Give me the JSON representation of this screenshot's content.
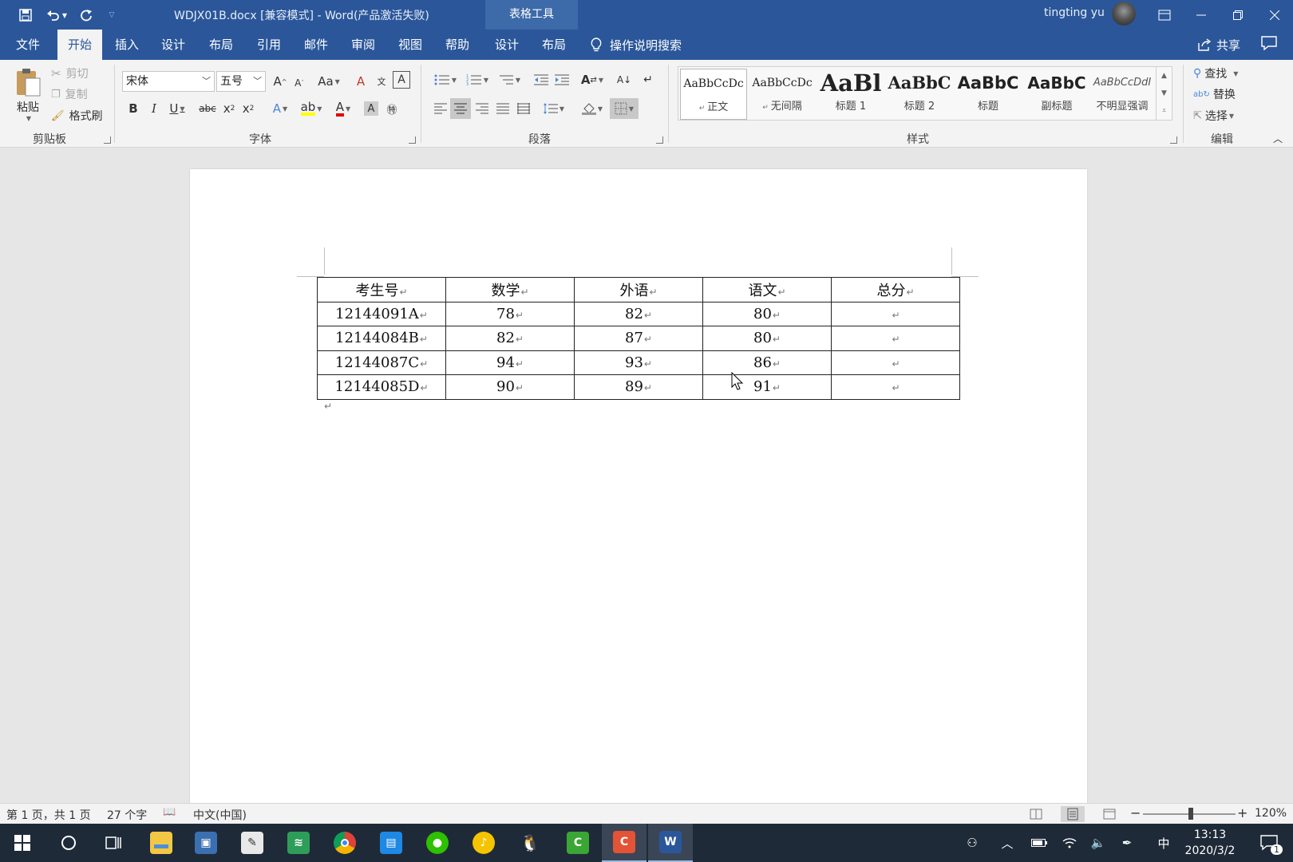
{
  "titlebar": {
    "doc_title": "WDJX01B.docx [兼容模式]  -  Word(产品激活失败)",
    "table_tools": "表格工具",
    "user_name": "tingting yu"
  },
  "tabs": [
    {
      "label": "文件"
    },
    {
      "label": "开始"
    },
    {
      "label": "插入"
    },
    {
      "label": "设计"
    },
    {
      "label": "布局"
    },
    {
      "label": "引用"
    },
    {
      "label": "邮件"
    },
    {
      "label": "审阅"
    },
    {
      "label": "视图"
    },
    {
      "label": "帮助"
    },
    {
      "label": "设计"
    },
    {
      "label": "布局"
    }
  ],
  "search_hint": "操作说明搜索",
  "share_label": "共享",
  "clipboard": {
    "paste": "粘贴",
    "cut": "剪切",
    "copy": "复制",
    "format_painter": "格式刷",
    "group_label": "剪贴板"
  },
  "font": {
    "name": "宋体",
    "size": "五号",
    "group_label": "字体",
    "aa": "Aa"
  },
  "paragraph": {
    "group_label": "段落"
  },
  "styles": {
    "group_label": "样式",
    "items": [
      {
        "preview": "AaBbCcDc",
        "name": "正文"
      },
      {
        "preview": "AaBbCcDc",
        "name": "无间隔"
      },
      {
        "preview": "AaBl",
        "name": "标题 1"
      },
      {
        "preview": "AaBbC",
        "name": "标题 2"
      },
      {
        "preview": "AaBbC",
        "name": "标题"
      },
      {
        "preview": "AaBbC",
        "name": "副标题"
      },
      {
        "preview": "AaBbCcDdI",
        "name": "不明显强调"
      }
    ]
  },
  "editing": {
    "find": "查找",
    "replace": "替换",
    "select": "选择",
    "group_label": "编辑"
  },
  "table": {
    "headers": [
      "考生号",
      "数学",
      "外语",
      "语文",
      "总分"
    ],
    "rows": [
      [
        "12144091A",
        "78",
        "82",
        "80",
        ""
      ],
      [
        "12144084B",
        "82",
        "87",
        "80",
        ""
      ],
      [
        "12144087C",
        "94",
        "93",
        "86",
        ""
      ],
      [
        "12144085D",
        "90",
        "89",
        "91",
        ""
      ]
    ],
    "para_mark": "↵"
  },
  "statusbar": {
    "page": "第 1 页，共 1 页",
    "words": "27 个字",
    "language": "中文(中国)",
    "zoom": "120%"
  },
  "taskbar": {
    "time": "13:13",
    "date": "2020/3/2",
    "ime": "中",
    "notifications": "1"
  }
}
